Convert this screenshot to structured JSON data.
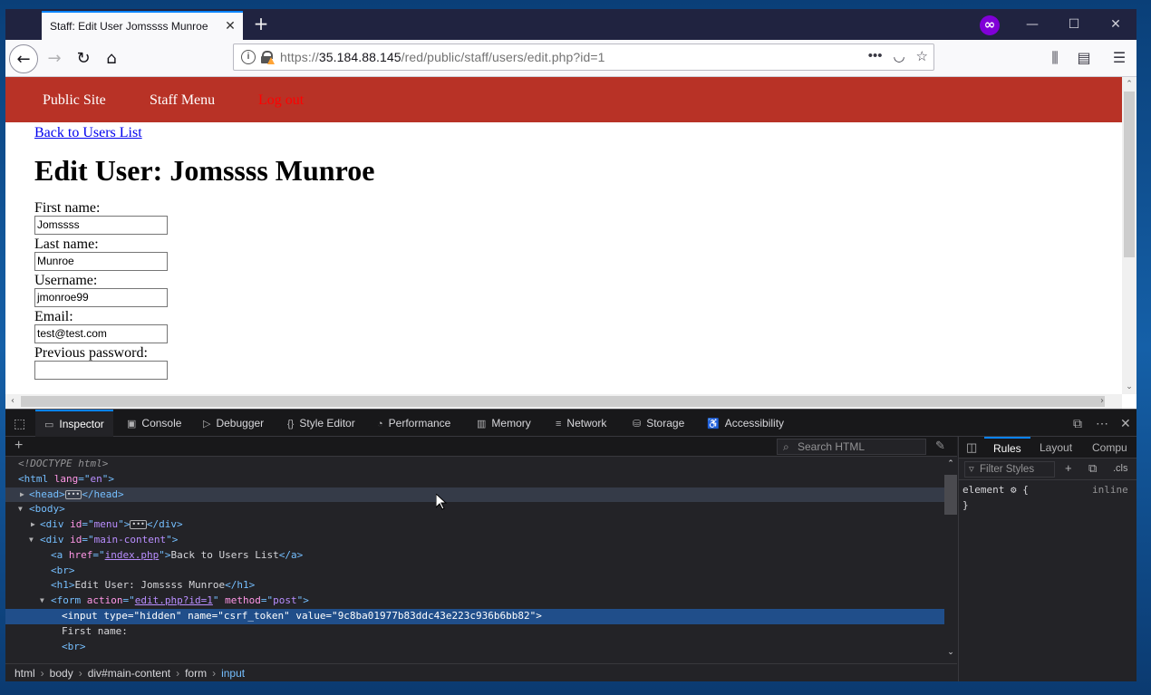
{
  "browser": {
    "tab_title": "Staff: Edit User Jomssss Munroe",
    "tab_close": "✕",
    "new_tab": "+",
    "url_prefix": "https://",
    "url_host": "35.184.88.145",
    "url_path": "/red/public/staff/users/edit.php?id=1",
    "icons": [
      "back-icon",
      "forward-icon",
      "reload-icon",
      "home-icon",
      "info-icon",
      "lock-icon",
      "more-icon",
      "pocket-icon",
      "bookmark-star-icon",
      "library-icon",
      "sidebar-icon",
      "menu-icon",
      "private-mask-icon"
    ]
  },
  "site_menu": {
    "public_site": "Public Site",
    "staff_menu": "Staff Menu",
    "logout": "Log out"
  },
  "page": {
    "back_link": "Back to Users List",
    "heading": "Edit User: Jomssss Munroe",
    "fields": [
      {
        "label": "First name:",
        "value": "Jomssss"
      },
      {
        "label": "Last name:",
        "value": "Munroe"
      },
      {
        "label": "Username:",
        "value": "jmonroe99"
      },
      {
        "label": "Email:",
        "value": "test@test.com"
      },
      {
        "label": "Previous password:",
        "value": ""
      }
    ]
  },
  "devtools": {
    "tabs": [
      "Inspector",
      "Console",
      "Debugger",
      "Style Editor",
      "Performance",
      "Memory",
      "Network",
      "Storage",
      "Accessibility"
    ],
    "active_tab": "Inspector",
    "search_placeholder": "Search HTML",
    "breadcrumbs": [
      "html",
      "body",
      "div#main-content",
      "form",
      "input"
    ],
    "rules_tabs": [
      "Rules",
      "Layout",
      "Compu"
    ],
    "filter_placeholder": "Filter Styles",
    "cls_label": ".cls",
    "rule_selector": "element",
    "rule_source": "inline",
    "tree": {
      "doctype": "<!DOCTYPE html>",
      "lang_value": "en",
      "div_menu_id": "menu",
      "div_main_id": "main-content",
      "a_href": "index.php",
      "a_text": "Back to Users List",
      "h1_text": "Edit User: Jomssss Munroe",
      "form_action": "edit.php?id=1",
      "form_method": "post",
      "input_type": "hidden",
      "input_name": "csrf_token",
      "input_value": "9c8ba01977b83ddc43e223c936b6bb82",
      "first_name_text": "First name:"
    }
  }
}
